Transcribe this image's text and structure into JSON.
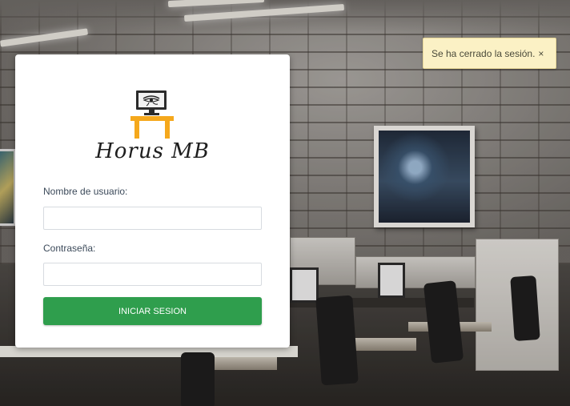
{
  "toast": {
    "message": "Se ha cerrado la sesión.",
    "close_label": "×"
  },
  "login": {
    "brand_name": "Horus MB",
    "logo_icon": "computer-desk-eye-icon",
    "username_label": "Nombre de usuario:",
    "username_value": "",
    "username_placeholder": "",
    "password_label": "Contraseña:",
    "password_value": "",
    "password_placeholder": "",
    "submit_label": "INICIAR SESION"
  },
  "colors": {
    "submit_button": "#2f9e4d",
    "toast_background": "#fbf1c5",
    "logo_desk": "#f5a81c",
    "card_background": "#ffffff"
  }
}
